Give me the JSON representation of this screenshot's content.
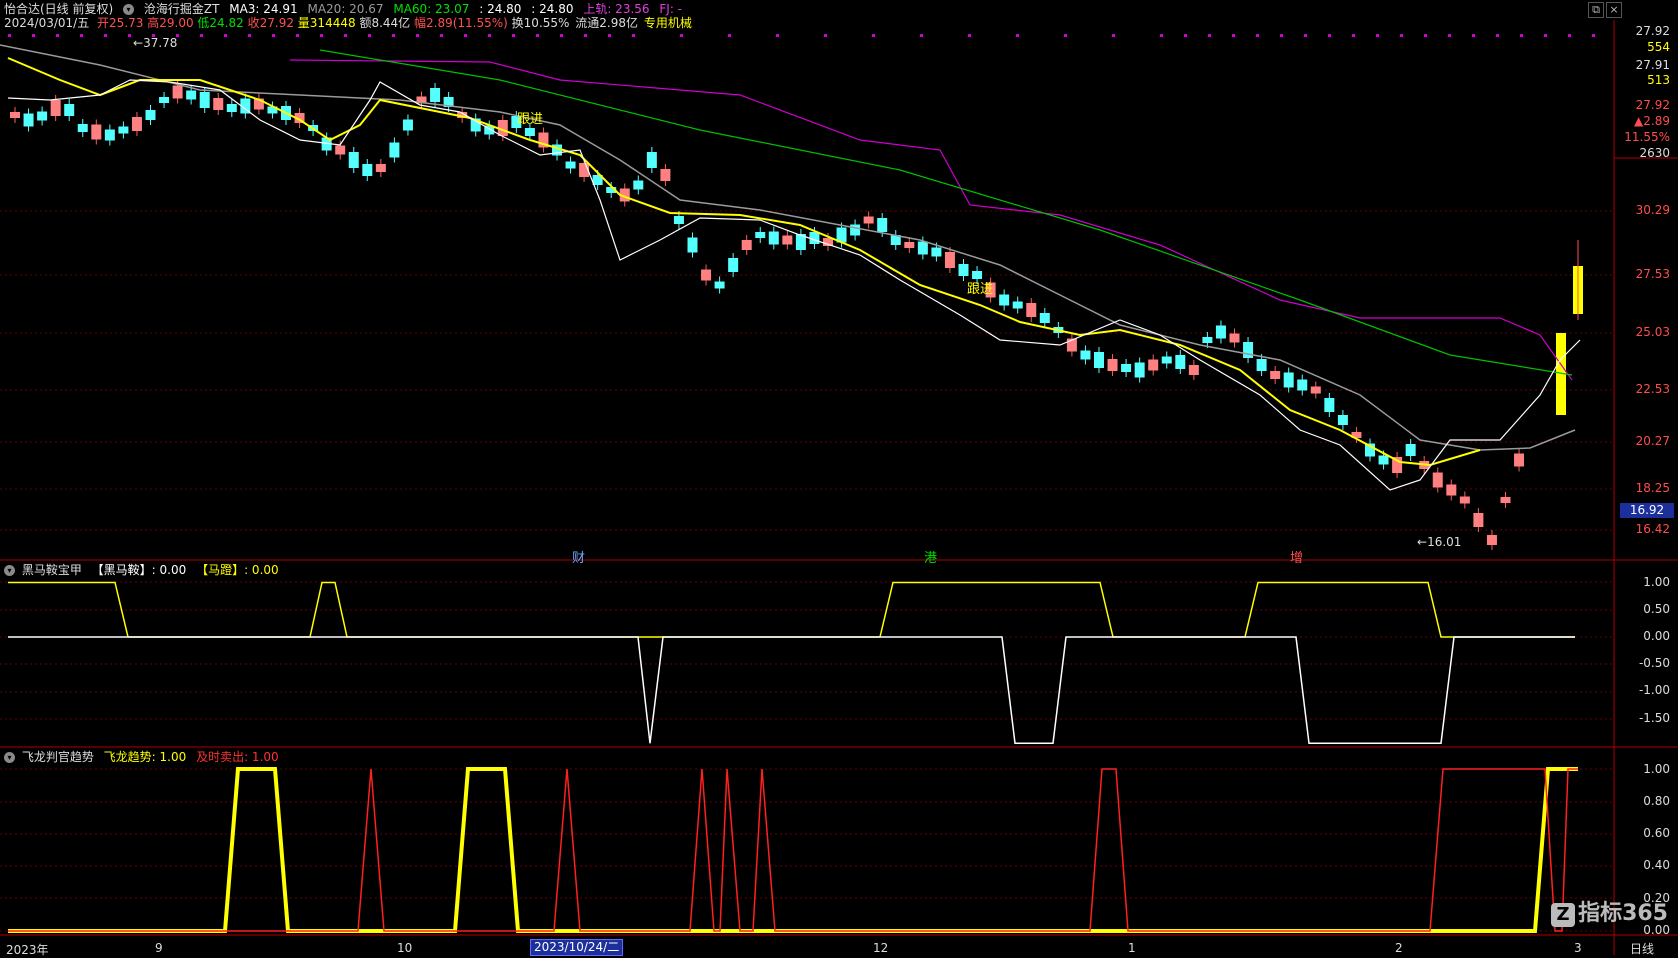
{
  "header": {
    "stock_name": "怡合达(日线 前复权)",
    "indicator_name": "沧海行掘金ZT",
    "ma3": "MA3: 24.91",
    "ma20": "MA20: 20.67",
    "ma60": "MA60: 23.07",
    "val1": ": 24.80",
    "val2": ": 24.80",
    "upper": "上轨: 23.56",
    "fj": "FJ: -"
  },
  "info_line": {
    "date": "2024/03/01/五",
    "open": "开25.73",
    "high": "高29.00",
    "low": "低24.82",
    "close": "收27.92",
    "volume": "量314448",
    "amount": "额8.44亿",
    "change": "幅2.89(11.55%)",
    "turnover": "换10.55%",
    "float": "流通2.98亿",
    "sector": "专用机械"
  },
  "right_quote": {
    "price1": "27.92",
    "vol1": "554",
    "price2": "27.91",
    "vol2": "513",
    "price3": "27.92",
    "change": "▲2.89",
    "pct": "11.55%",
    "count": "2630"
  },
  "price_axis": [
    "30.29",
    "27.53",
    "25.03",
    "22.53",
    "20.27",
    "18.25",
    "16.42"
  ],
  "current_price_box": "16.92",
  "annotations": {
    "high_label": "37.78",
    "low_label": "16.01",
    "follow1": "跟进",
    "follow2": "跟进",
    "cat1": "财",
    "cat2": "港",
    "cat3": "增"
  },
  "panel1": {
    "title": "黑马鞍宝甲",
    "label_a": "【黑马鞍】: 0.00",
    "label_b": "【马蹬】: 0.00",
    "axis": [
      "1.00",
      "0.50",
      "0.00",
      "-0.50",
      "-1.00",
      "-1.50"
    ]
  },
  "panel2": {
    "title": "飞龙判官趋势",
    "label_a": "飞龙趋势: 1.00",
    "label_b": "及时卖出: 1.00",
    "axis": [
      "1.00",
      "0.80",
      "0.60",
      "0.40",
      "0.20",
      "0.00"
    ]
  },
  "x_axis": [
    "2023年",
    "9",
    "10",
    "1",
    "12",
    "1",
    "2",
    "3"
  ],
  "x_selected_date": "2023/10/24/二",
  "period_label": "日线",
  "logo_text": "指标365",
  "colors": {
    "up": "#ff5b5b",
    "down": "#54ffff",
    "ma_white": "#ffffff",
    "ma_yellow": "#ffff00",
    "ma_gray": "#9a9a9a",
    "ma_green": "#00c000",
    "ma_magenta": "#d000d0",
    "grid_red": "#8b0000"
  }
}
